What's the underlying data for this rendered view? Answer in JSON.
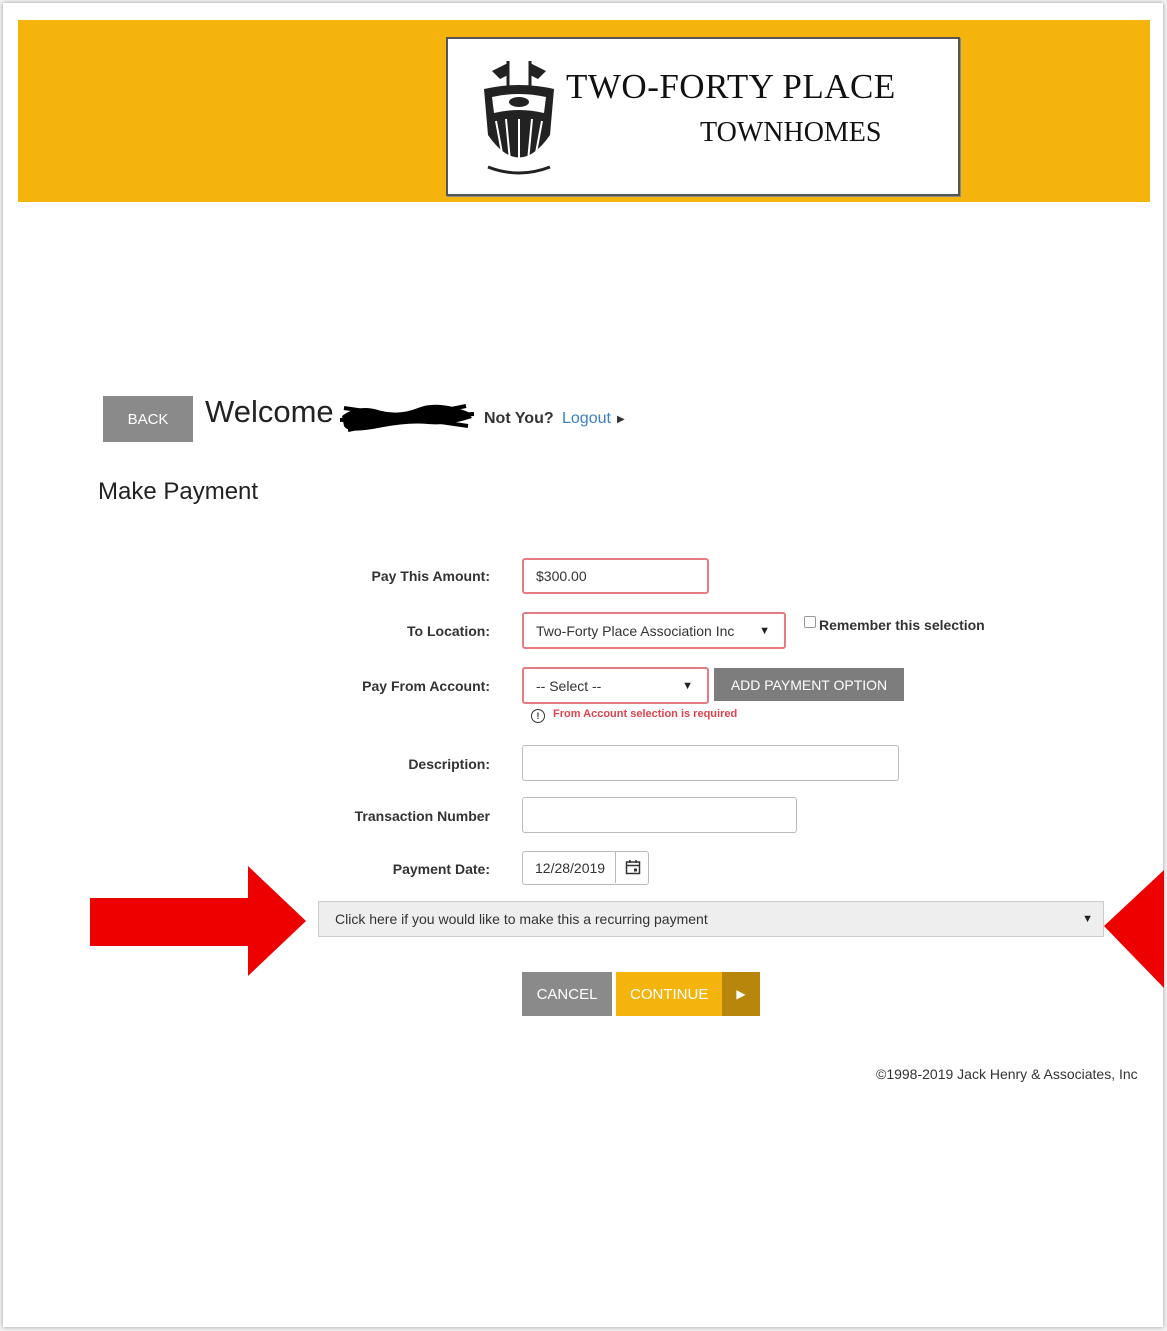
{
  "header": {
    "logo_line1": "TWO-FORTY PLACE",
    "logo_line2": "TOWNHOMES",
    "banner_color": "#f5b40b"
  },
  "user_bar": {
    "back_label": "BACK",
    "welcome_text": "Welcome",
    "not_you_text": "Not You?",
    "logout_label": "Logout"
  },
  "page_title": "Make Payment",
  "form": {
    "pay_amount": {
      "label": "Pay This Amount:",
      "value": "$300.00"
    },
    "to_location": {
      "label": "To Location:",
      "value": "Two-Forty Place Association Inc",
      "remember_label": "Remember this selection"
    },
    "pay_from": {
      "label": "Pay From Account:",
      "value": "-- Select --",
      "add_option_label": "ADD PAYMENT OPTION",
      "error_text": "From Account selection is required"
    },
    "description": {
      "label": "Description:",
      "value": ""
    },
    "transaction_number": {
      "label": "Transaction Number",
      "value": ""
    },
    "payment_date": {
      "label": "Payment Date:",
      "value": "12/28/2019"
    },
    "recurring_text": "Click here if you would like to make this a recurring payment"
  },
  "actions": {
    "cancel_label": "CANCEL",
    "continue_label": "CONTINUE"
  },
  "footer": {
    "copyright": "©1998-2019 Jack Henry & Associates, Inc"
  },
  "colors": {
    "accent": "#f5b40b",
    "error": "#e0434f",
    "link": "#3b7fc4",
    "annotation_arrow": "#ee0000"
  }
}
